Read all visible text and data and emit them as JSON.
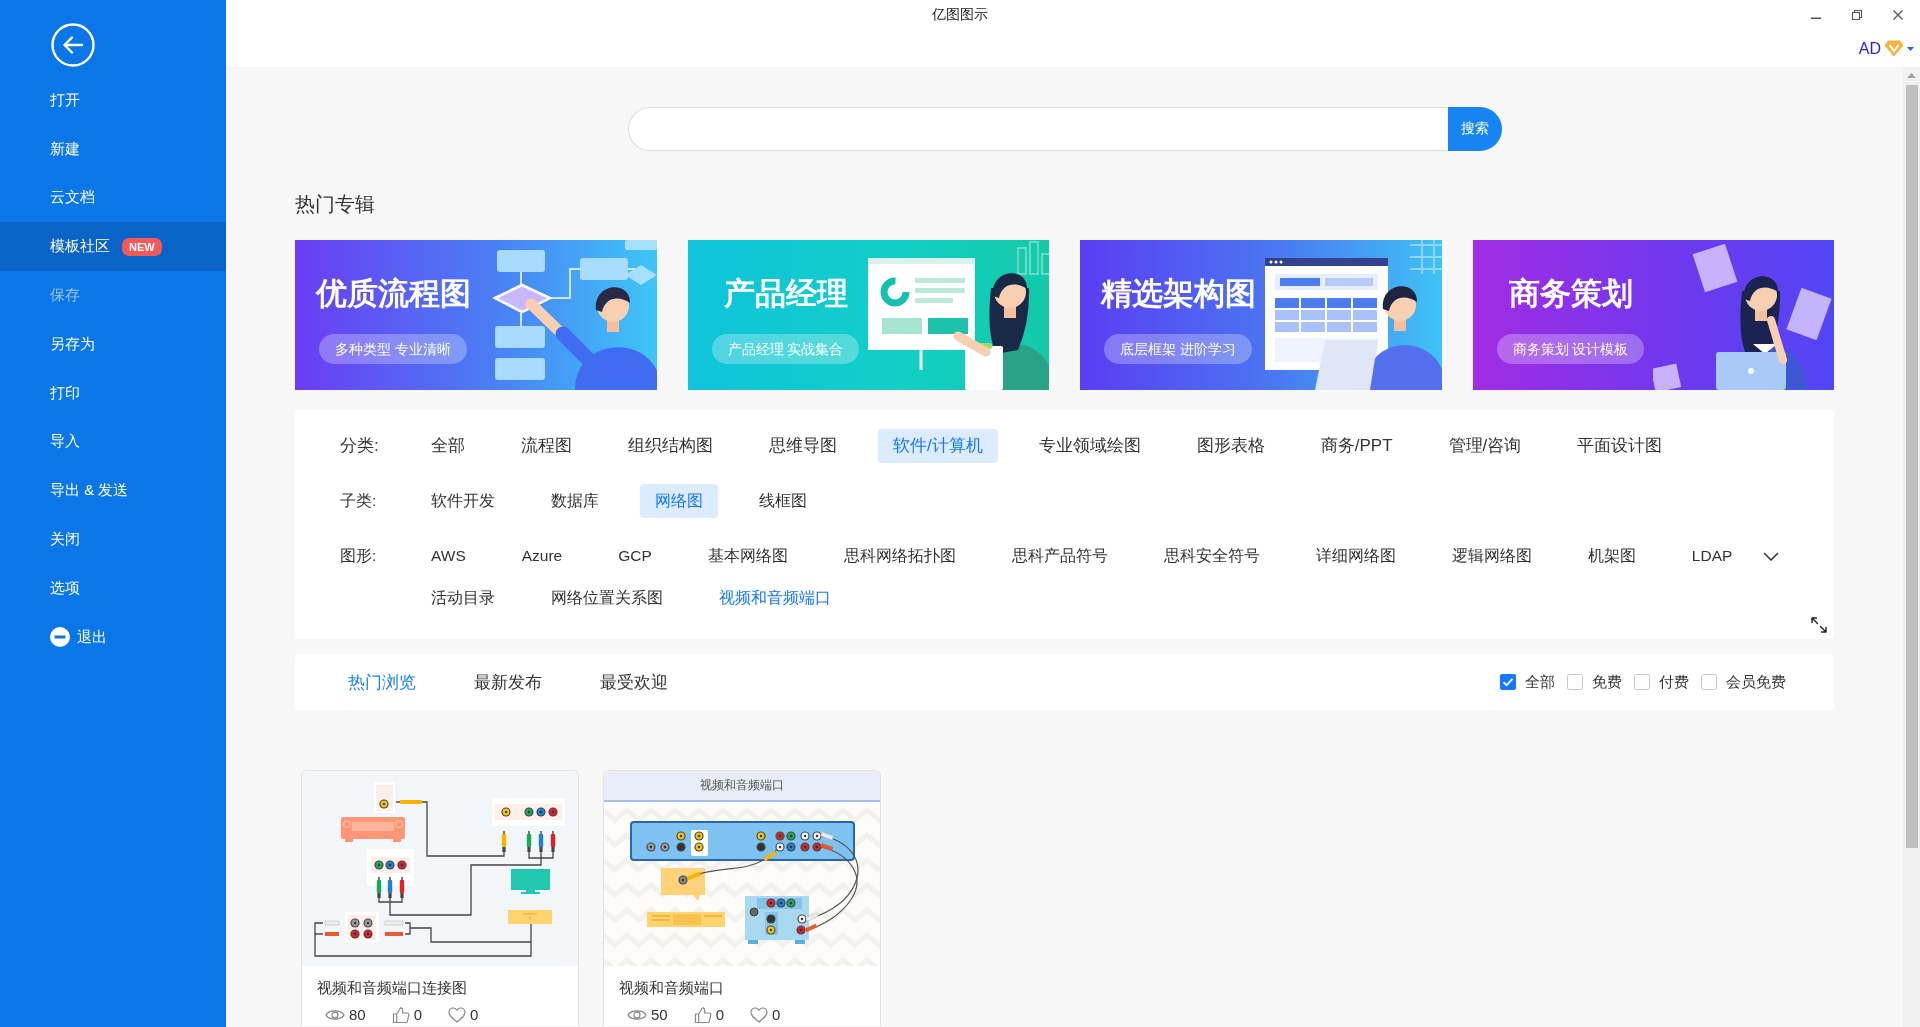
{
  "window": {
    "title": "亿图图示"
  },
  "account": {
    "initials": "AD"
  },
  "sidebar": {
    "items": [
      {
        "kind": "item",
        "label": "打开",
        "selected": false,
        "disabled": false
      },
      {
        "kind": "item",
        "label": "新建",
        "selected": false,
        "disabled": false
      },
      {
        "kind": "item",
        "label": "云文档",
        "selected": false,
        "disabled": false
      },
      {
        "kind": "item",
        "label": "模板社区",
        "selected": true,
        "disabled": false,
        "badge": "NEW"
      },
      {
        "kind": "item",
        "label": "保存",
        "selected": false,
        "disabled": true
      },
      {
        "kind": "item",
        "label": "另存为",
        "selected": false,
        "disabled": false
      },
      {
        "kind": "item",
        "label": "打印",
        "selected": false,
        "disabled": false
      },
      {
        "kind": "item",
        "label": "导入",
        "selected": false,
        "disabled": false
      },
      {
        "kind": "item",
        "label": "导出 & 发送",
        "selected": false,
        "disabled": false
      },
      {
        "kind": "item",
        "label": "关闭",
        "selected": false,
        "disabled": false
      },
      {
        "kind": "item",
        "label": "选项",
        "selected": false,
        "disabled": false
      },
      {
        "kind": "exit",
        "label": "退出",
        "selected": false,
        "disabled": false
      }
    ]
  },
  "search": {
    "button": "搜索"
  },
  "featured": {
    "title": "热门专辑",
    "banners": [
      {
        "kind": "flowchart",
        "title": "优质流程图",
        "subtitle": "多种类型 专业清晰"
      },
      {
        "kind": "product",
        "title": "产品经理",
        "subtitle": "产品经理 实战集合"
      },
      {
        "kind": "architecture",
        "title": "精选架构图",
        "subtitle": "底层框架 进阶学习"
      },
      {
        "kind": "business",
        "title": "商务策划",
        "subtitle": "商务策划 设计模板"
      }
    ]
  },
  "filters": {
    "rows": [
      {
        "kind": "category",
        "label": "分类:",
        "options": [
          {
            "label": "全部",
            "selected": false
          },
          {
            "label": "流程图",
            "selected": false
          },
          {
            "label": "组织结构图",
            "selected": false
          },
          {
            "label": "思维导图",
            "selected": false
          },
          {
            "label": "软件/计算机",
            "selected": true
          },
          {
            "label": "专业领域绘图",
            "selected": false
          },
          {
            "label": "图形表格",
            "selected": false
          },
          {
            "label": "商务/PPT",
            "selected": false
          },
          {
            "label": "管理/咨询",
            "selected": false
          },
          {
            "label": "平面设计图",
            "selected": false
          }
        ]
      },
      {
        "kind": "subcategory",
        "label": "子类:",
        "options": [
          {
            "label": "软件开发",
            "selected": false
          },
          {
            "label": "数据库",
            "selected": false
          },
          {
            "label": "网络图",
            "selected": true
          },
          {
            "label": "线框图",
            "selected": false
          }
        ]
      },
      {
        "kind": "shape",
        "label": "图形:",
        "expandable": true,
        "options": [
          {
            "label": "AWS",
            "selected": false
          },
          {
            "label": "Azure",
            "selected": false
          },
          {
            "label": "GCP",
            "selected": false
          },
          {
            "label": "基本网络图",
            "selected": false
          },
          {
            "label": "思科网络拓扑图",
            "selected": false
          },
          {
            "label": "思科产品符号",
            "selected": false
          },
          {
            "label": "思科安全符号",
            "selected": false
          },
          {
            "label": "详细网络图",
            "selected": false
          },
          {
            "label": "逻辑网络图",
            "selected": false
          },
          {
            "label": "机架图",
            "selected": false
          },
          {
            "label": "LDAP",
            "selected": false
          },
          {
            "label": "活动目录",
            "selected": false
          },
          {
            "label": "网络位置关系图",
            "selected": false
          },
          {
            "label": "视频和音频端口",
            "selected": true
          }
        ]
      }
    ]
  },
  "listing": {
    "tabs": [
      {
        "label": "热门浏览",
        "selected": true
      },
      {
        "label": "最新发布",
        "selected": false
      },
      {
        "label": "最受欢迎",
        "selected": false
      }
    ],
    "price_filters": [
      {
        "label": "全部",
        "checked": true
      },
      {
        "label": "免费",
        "checked": false
      },
      {
        "label": "付费",
        "checked": false
      },
      {
        "label": "会员免费",
        "checked": false
      }
    ]
  },
  "templates": [
    {
      "kind": "wiring",
      "title": "视频和音频端口连接图",
      "views": "80",
      "likes": "0",
      "favorites": "0"
    },
    {
      "kind": "ports",
      "header": "视频和音频端口",
      "title": "视频和音频端口",
      "views": "50",
      "likes": "0",
      "favorites": "0"
    }
  ]
}
